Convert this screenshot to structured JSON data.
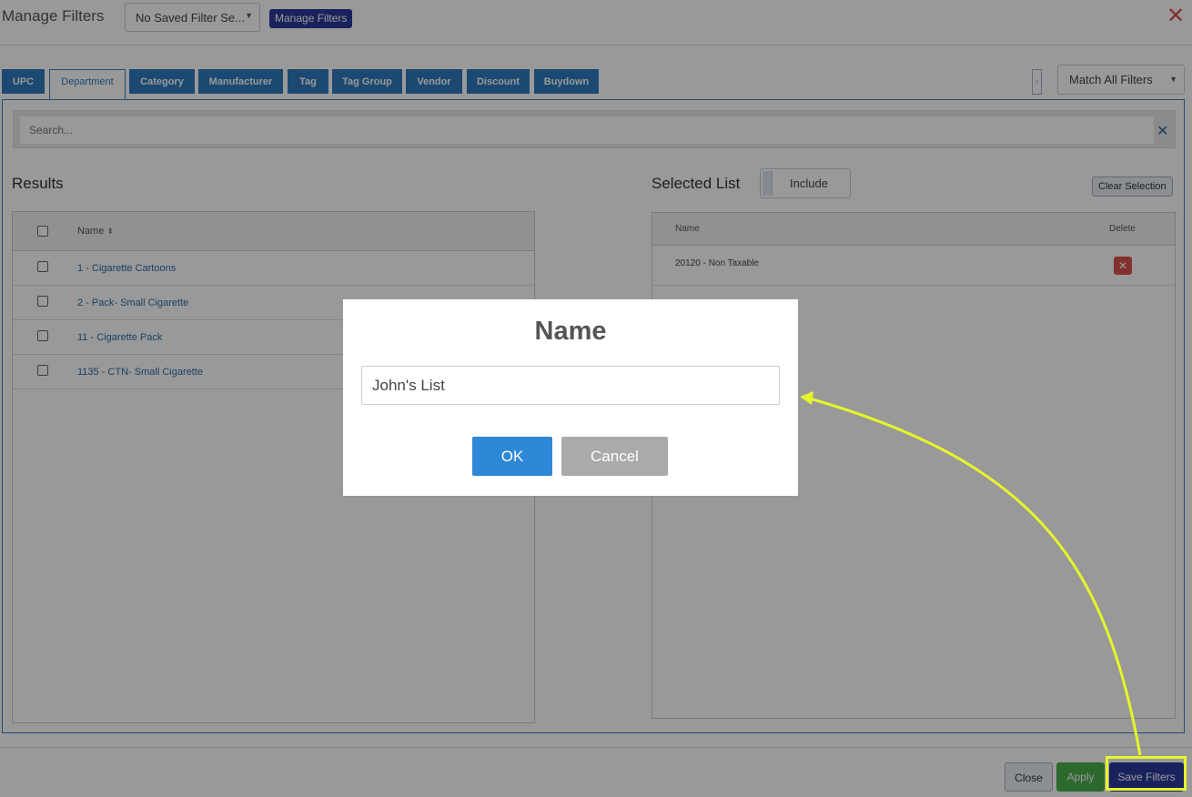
{
  "header": {
    "title": "Manage Filters",
    "saved_filter_select": "No Saved Filter Se...",
    "manage_filters_button": "Manage Filters"
  },
  "tabs": [
    {
      "label": "UPC"
    },
    {
      "label": "Department",
      "active": true
    },
    {
      "label": "Category"
    },
    {
      "label": "Manufacturer"
    },
    {
      "label": "Tag"
    },
    {
      "label": "Tag Group"
    },
    {
      "label": "Vendor"
    },
    {
      "label": "Discount"
    },
    {
      "label": "Buydown"
    }
  ],
  "match_select": "Match All Filters",
  "search": {
    "placeholder": "Search..."
  },
  "results": {
    "heading": "Results",
    "column_name": "Name",
    "rows": [
      "1 - Cigarette Cartoons",
      "2 - Pack- Small Cigarette",
      "11 - Cigarette Pack",
      "1135 - CTN- Small Cigarette"
    ]
  },
  "selected": {
    "heading": "Selected List",
    "toggle_label": "Include",
    "clear_button": "Clear Selection",
    "column_name": "Name",
    "column_delete": "Delete",
    "rows": [
      "20120 - Non Taxable"
    ]
  },
  "footer": {
    "close": "Close",
    "apply": "Apply",
    "save_filters": "Save Filters"
  },
  "modal": {
    "title": "Name",
    "input_value": "John's List",
    "ok": "OK",
    "cancel": "Cancel"
  },
  "colors": {
    "tab_blue": "#2e7bbf",
    "save_button": "#2b3a9a",
    "apply_button": "#4cae4c",
    "ok_button": "#2f87d8",
    "annotation_yellow": "#e6f52a"
  }
}
